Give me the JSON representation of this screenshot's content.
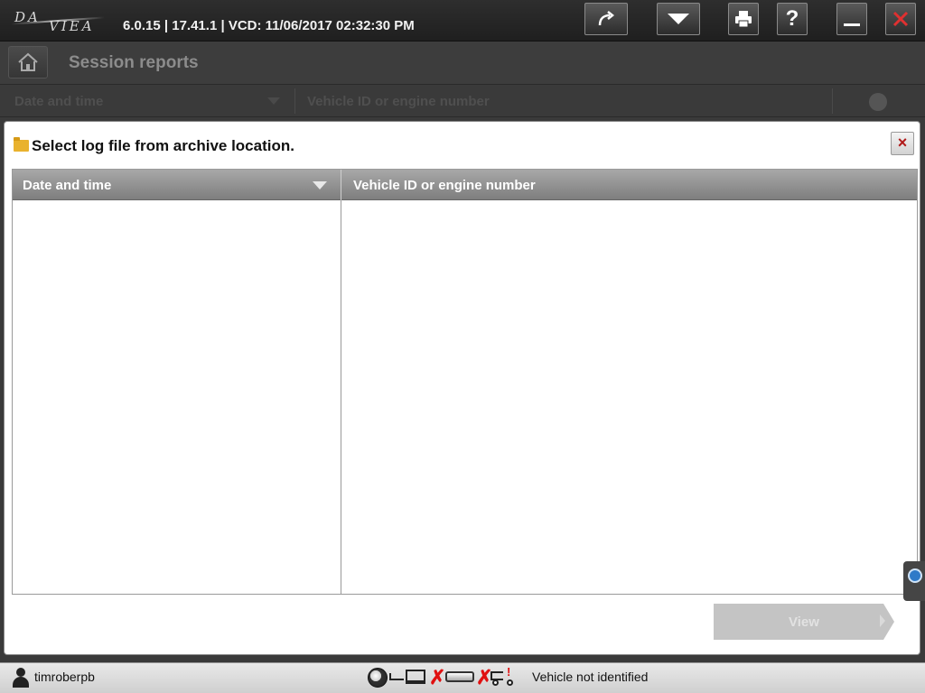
{
  "app": {
    "logo_line1": "DA",
    "logo_line2": "VIEA",
    "version_info": "6.0.15 | 17.41.1 | VCD: 11/06/2017 02:32:30 PM"
  },
  "toolbar": {
    "buttons": [
      {
        "name": "redo",
        "icon": "redo-arrow-icon"
      },
      {
        "name": "menu",
        "icon": "dropdown-triangle-icon"
      },
      {
        "name": "print",
        "icon": "printer-icon"
      },
      {
        "name": "help",
        "label": "?"
      },
      {
        "name": "minimize",
        "icon": "minimize-icon"
      },
      {
        "name": "close",
        "icon": "close-icon"
      }
    ]
  },
  "session": {
    "title": "Session reports",
    "columns": [
      "Date and time",
      "Vehicle ID or engine number"
    ]
  },
  "dialog": {
    "title": "Select log file from archive location.",
    "close_label": "×",
    "table": {
      "headers": [
        "Date and time",
        "Vehicle ID or engine number"
      ],
      "rows": []
    },
    "view_button": "View"
  },
  "status": {
    "username": "timroberpb",
    "vehicle_status": "Vehicle not identified",
    "icons": [
      "globe-icon",
      "connection-line-icon",
      "laptop-icon",
      "error-x-icon",
      "vci-cable-icon",
      "error-x-icon",
      "truck-warning-icon"
    ]
  },
  "colors": {
    "titlebar": "#262626",
    "header_gradient_top": "#a8a8a8",
    "error_red": "#e01010",
    "folder": "#e9b22e"
  }
}
